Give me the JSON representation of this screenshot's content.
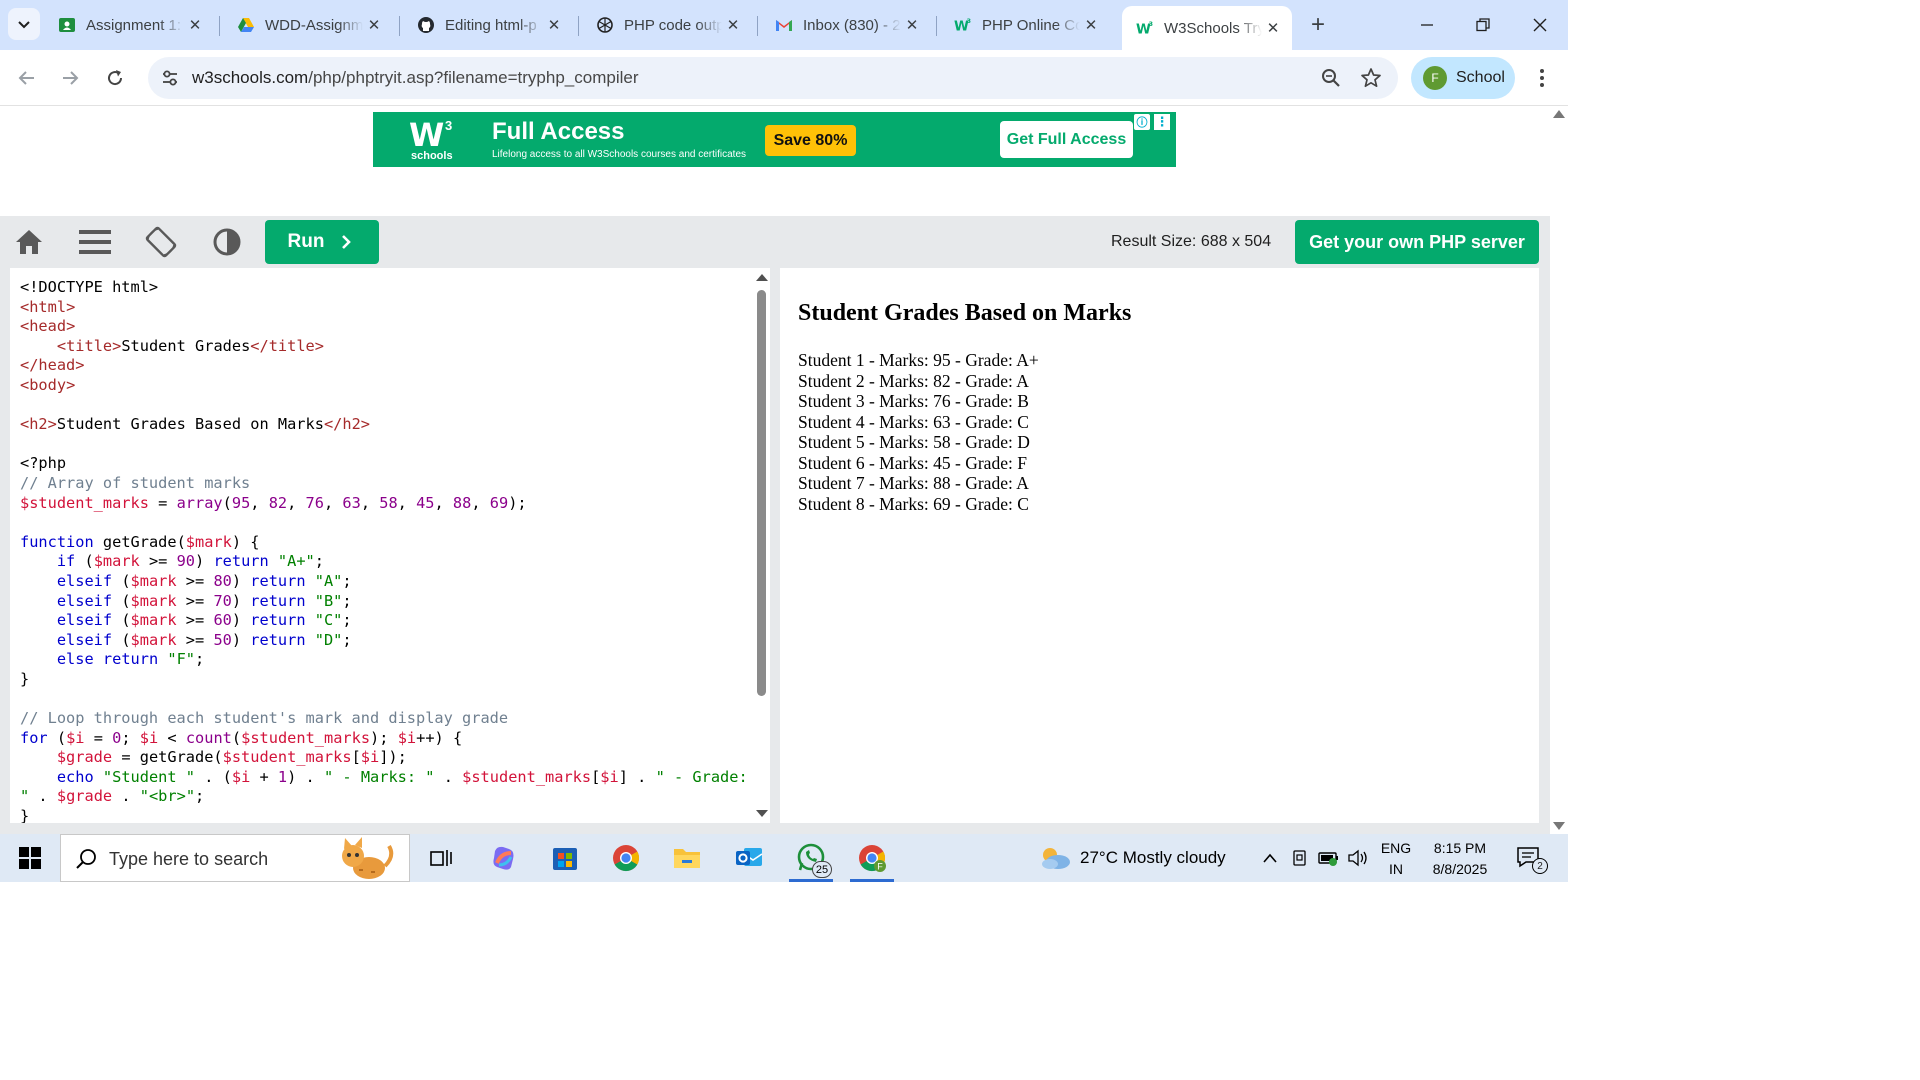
{
  "browser": {
    "tabs": [
      {
        "title": "Assignment 1:",
        "icon": "classroom-icon"
      },
      {
        "title": "WDD-Assignm",
        "icon": "drive-icon"
      },
      {
        "title": "Editing html-p",
        "icon": "github-icon"
      },
      {
        "title": "PHP code outp",
        "icon": "chatgpt-icon"
      },
      {
        "title": "Inbox (830) - 2",
        "icon": "gmail-icon"
      },
      {
        "title": "PHP Online Co",
        "icon": "w3schools-icon"
      },
      {
        "title": "W3Schools Try",
        "icon": "w3schools-icon"
      }
    ],
    "active_tab": 6,
    "url_host": "w3schools.com",
    "url_path": "/php/phptryit.asp?filename=tryphp_compiler",
    "profile_initial": "F",
    "profile_label": "School"
  },
  "ad": {
    "logo_mark": "W",
    "logo_sup": "3",
    "logo_word": "schools",
    "headline": "Full Access",
    "subline": "Lifelong access to all W3Schools courses and certificates",
    "badge": "Save 80%",
    "cta": "Get Full Access",
    "info_icon": "ⓘ",
    "close_icon": "⋮"
  },
  "tryit": {
    "run_label": "Run",
    "result_size": "Result Size: 688 x 504",
    "server_cta": "Get your own PHP server"
  },
  "code_lines": [
    "<!DOCTYPE html>",
    "<html>",
    "<head>",
    "    <title>Student Grades</title>",
    "</head>",
    "<body>",
    "",
    "<h2>Student Grades Based on Marks</h2>",
    "",
    "<?php",
    "// Array of student marks",
    "$student_marks = array(95, 82, 76, 63, 58, 45, 88, 69);",
    "",
    "function getGrade($mark) {",
    "    if ($mark >= 90) return \"A+\";",
    "    elseif ($mark >= 80) return \"A\";",
    "    elseif ($mark >= 70) return \"B\";",
    "    elseif ($mark >= 60) return \"C\";",
    "    elseif ($mark >= 50) return \"D\";",
    "    else return \"F\";",
    "}",
    "",
    "// Loop through each student's mark and display grade",
    "for ($i = 0; $i < count($student_marks); $i++) {",
    "    $grade = getGrade($student_marks[$i]);",
    "    echo \"Student \" . ($i + 1) . \" - Marks: \" . $student_marks[$i] . \" - Grade:",
    "\" . $grade . \"<br>\";",
    "}"
  ],
  "result": {
    "heading": "Student Grades Based on Marks",
    "lines": [
      "Student 1 - Marks: 95 - Grade: A+",
      "Student 2 - Marks: 82 - Grade: A",
      "Student 3 - Marks: 76 - Grade: B",
      "Student 4 - Marks: 63 - Grade: C",
      "Student 5 - Marks: 58 - Grade: D",
      "Student 6 - Marks: 45 - Grade: F",
      "Student 7 - Marks: 88 - Grade: A",
      "Student 8 - Marks: 69 - Grade: C"
    ]
  },
  "taskbar": {
    "search_placeholder": "Type here to search",
    "whatsapp_badge": "25",
    "weather": "27°C  Mostly cloudy",
    "lang_top": "ENG",
    "lang_bottom": "IN",
    "time": "8:15 PM",
    "date": "8/8/2025",
    "notifications": "2"
  },
  "colors": {
    "w3_green": "#04aa6d",
    "tab_strip": "#d3e3fd",
    "profile_chip": "#c2e7ff"
  }
}
